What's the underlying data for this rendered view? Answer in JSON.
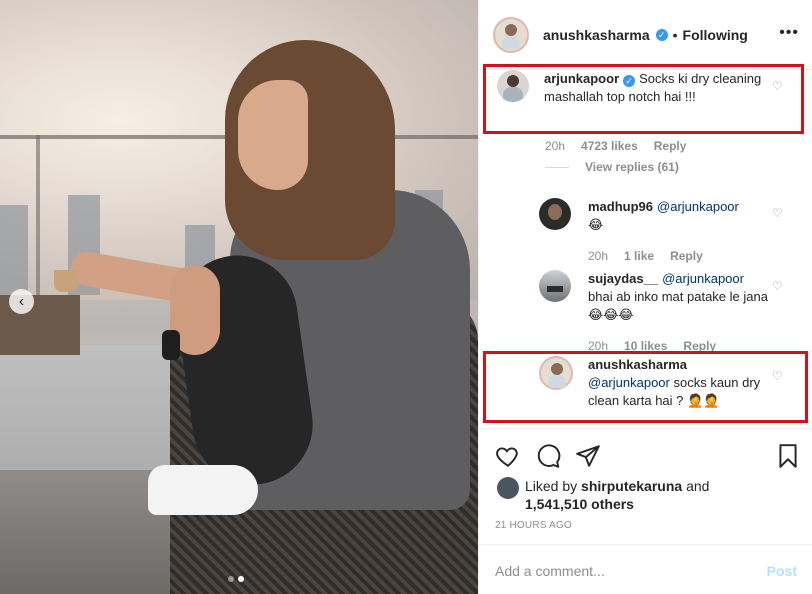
{
  "post": {
    "author": "anushkasharma",
    "separator": "•",
    "following_label": "Following",
    "more_label": "•••",
    "carousel_prev": "‹"
  },
  "comments": [
    {
      "user": "arjunkapoor",
      "verified": true,
      "text": "Socks ki dry cleaning mashallah top notch hai !!!",
      "time": "20h",
      "likes": "4723 likes",
      "reply_label": "Reply",
      "view_replies": "View replies (61)"
    },
    {
      "user": "madhup96",
      "mention": "@arjunkapoor",
      "text": "😂",
      "time": "20h",
      "likes": "1 like",
      "reply_label": "Reply"
    },
    {
      "user": "sujaydas__",
      "mention": "@arjunkapoor",
      "text": "bhai ab inko mat patake le jana 😂😂😂",
      "time": "20h",
      "likes": "10 likes",
      "reply_label": "Reply"
    },
    {
      "user": "anushkasharma",
      "mention": "@arjunkapoor",
      "text": "socks kaun dry clean karta hai ? 🤦🤦"
    }
  ],
  "liked_by": {
    "prefix": "Liked by",
    "user": "shirputekaruna",
    "and": "and",
    "others": "1,541,510 others"
  },
  "timestamp": "21 HOURS AGO",
  "add_comment": {
    "placeholder": "Add a comment...",
    "post_label": "Post"
  },
  "icons": {
    "heart": "heart-icon",
    "comment": "comment-icon",
    "share": "share-icon",
    "bookmark": "bookmark-icon"
  },
  "colors": {
    "highlight": "#d0121b",
    "verified": "#3897f0",
    "post_disabled": "#b2dffc"
  }
}
